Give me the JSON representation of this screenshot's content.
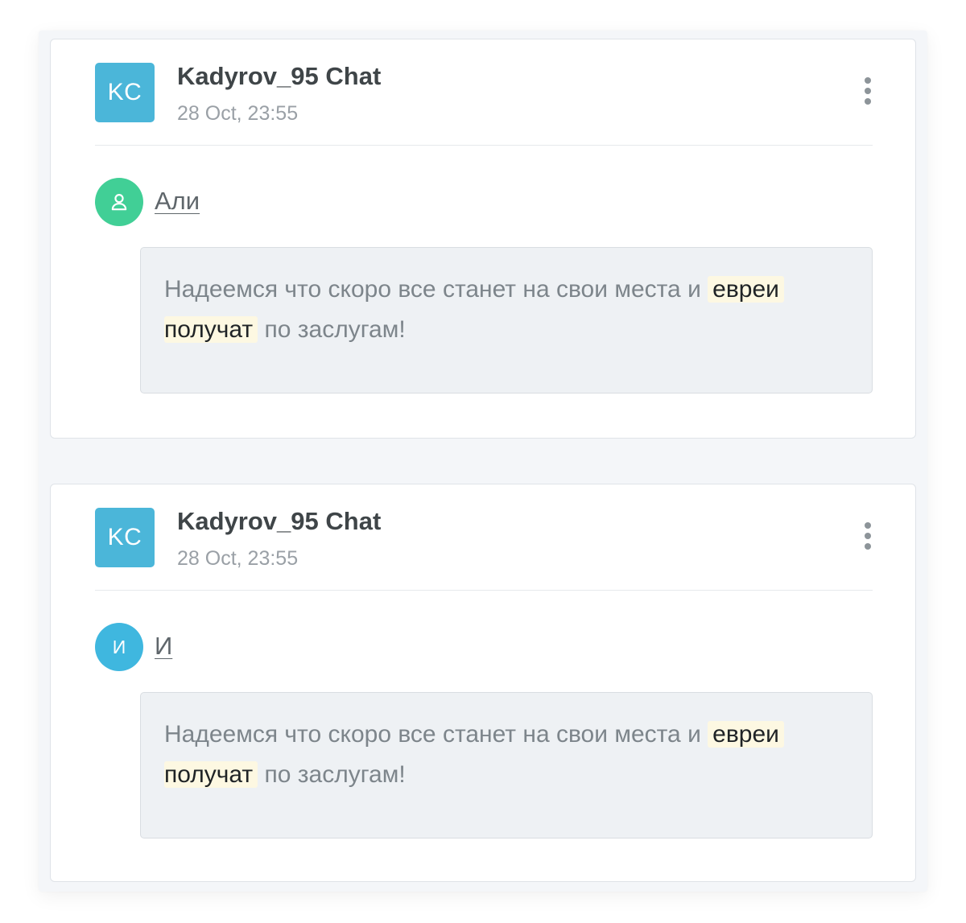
{
  "posts": [
    {
      "chat_initials": "KC",
      "chat_title": "Kadyrov_95 Chat",
      "timestamp": "28 Oct, 23:55",
      "author": {
        "name": "Али",
        "avatar_icon": "user-icon",
        "avatar_color": "#41cf96"
      },
      "message": {
        "line1_text": "Надеемся что скоро все станет на свои места и",
        "line1_highlight": "евреи",
        "line2_highlight": "получат",
        "line2_text": "по заслугам!"
      }
    },
    {
      "chat_initials": "KC",
      "chat_title": "Kadyrov_95 Chat",
      "timestamp": "28 Oct, 23:55",
      "author": {
        "name": "И",
        "avatar_initial": "И",
        "avatar_color": "#3fb7df"
      },
      "message": {
        "line1_text": "Надеемся что скоро все станет на свои места и",
        "line1_highlight": "евреи",
        "line2_highlight": "получат",
        "line2_text": "по заслугам!"
      }
    }
  ],
  "colors": {
    "chat_avatar": "#4bb6d9",
    "highlight_bg": "#fdf8e2",
    "message_bg": "#eef1f4"
  }
}
